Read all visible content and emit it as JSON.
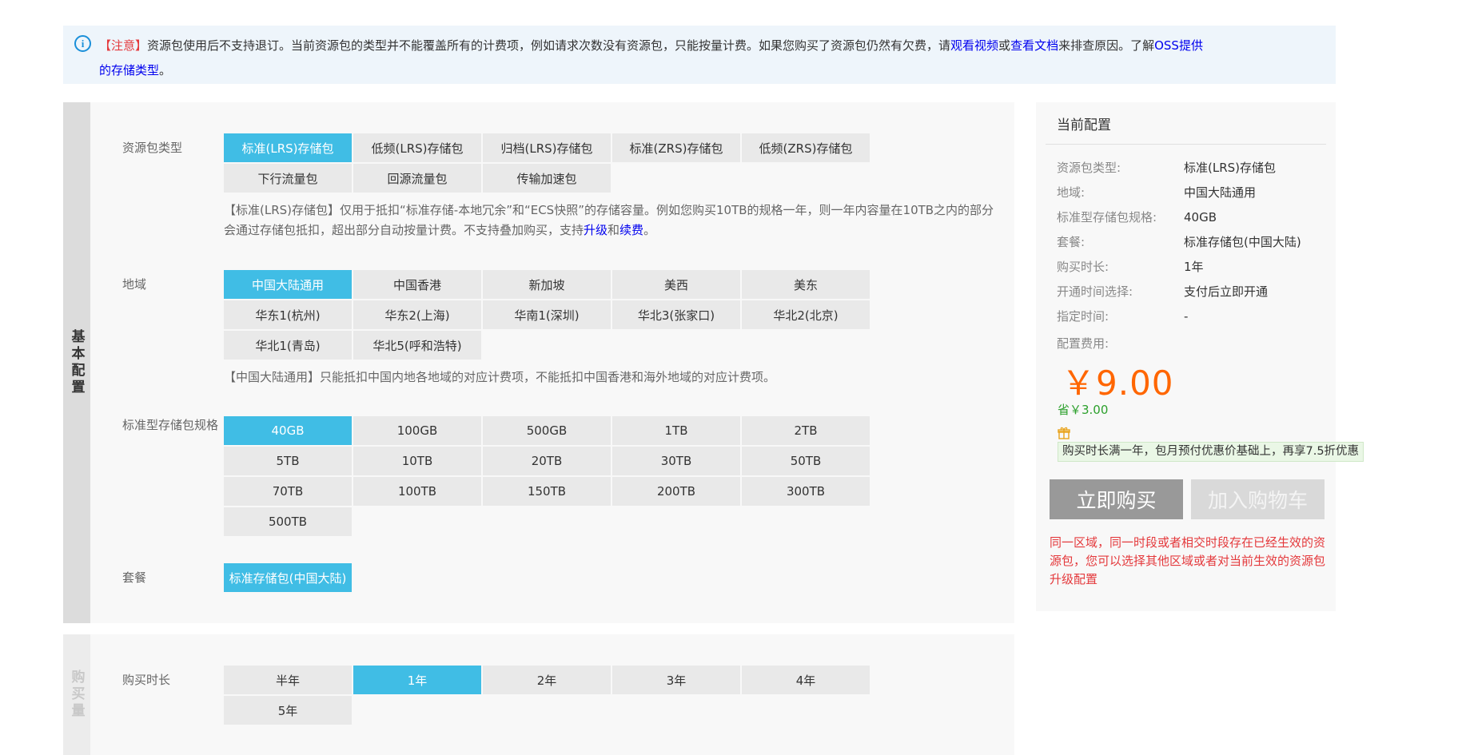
{
  "notice": {
    "icon": "info-icon",
    "tag": "【注意】",
    "text1": "资源包使用后不支持退订。当前资源包的类型并不能覆盖所有的计费项，例如请求次数没有资源包，只能按量计费。如果您购买了资源包仍然有欠费，请",
    "link_video": "观看视频",
    "text_or": "或",
    "link_doc": "查看文档",
    "text2": "来排查原因。了解",
    "link_oss": "OSS提供的存储类型",
    "text_end": "。"
  },
  "basic": {
    "side_label": "基本配置",
    "package_type": {
      "label": "资源包类型",
      "options": [
        "标准(LRS)存储包",
        "低频(LRS)存储包",
        "归档(LRS)存储包",
        "标准(ZRS)存储包",
        "低频(ZRS)存储包",
        "下行流量包",
        "回源流量包",
        "传输加速包"
      ],
      "selected": "标准(LRS)存储包",
      "desc1": "【标准(LRS)存储包】仅用于抵扣“标准存储-本地冗余”和“ECS快照”的存储容量。例如您购买10TB的规格一年，则一年内容量在10TB之内的部分会通过存储包抵扣，超出部分自动按量计费。不支持叠加购买，支持",
      "link_upgrade": "升级",
      "desc_and": "和",
      "link_renew": "续费",
      "desc_end": "。"
    },
    "region": {
      "label": "地域",
      "options": [
        "中国大陆通用",
        "中国香港",
        "新加坡",
        "美西",
        "美东",
        "华东1(杭州)",
        "华东2(上海)",
        "华南1(深圳)",
        "华北3(张家口)",
        "华北2(北京)",
        "华北1(青岛)",
        "华北5(呼和浩特)"
      ],
      "selected": "中国大陆通用",
      "desc": "【中国大陆通用】只能抵扣中国内地各地域的对应计费项，不能抵扣中国香港和海外地域的对应计费项。"
    },
    "spec": {
      "label": "标准型存储包规格",
      "options": [
        "40GB",
        "100GB",
        "500GB",
        "1TB",
        "2TB",
        "5TB",
        "10TB",
        "20TB",
        "30TB",
        "50TB",
        "70TB",
        "100TB",
        "150TB",
        "200TB",
        "300TB",
        "500TB"
      ],
      "selected": "40GB"
    },
    "plan": {
      "label": "套餐",
      "options": [
        "标准存储包(中国大陆)"
      ],
      "selected": "标准存储包(中国大陆)"
    }
  },
  "purchase": {
    "side_label": "购买量",
    "duration": {
      "label": "购买时长",
      "options": [
        "半年",
        "1年",
        "2年",
        "3年",
        "4年",
        "5年"
      ],
      "selected": "1年"
    }
  },
  "summary": {
    "title": "当前配置",
    "rows": [
      {
        "key": "资源包类型:",
        "value": "标准(LRS)存储包"
      },
      {
        "key": "地域:",
        "value": "中国大陆通用"
      },
      {
        "key": "标准型存储包规格:",
        "value": "40GB"
      },
      {
        "key": "套餐:",
        "value": "标准存储包(中国大陆)"
      },
      {
        "key": "购买时长:",
        "value": "1年"
      },
      {
        "key": "开通时间选择:",
        "value": "支付后立即开通"
      },
      {
        "key": "指定时间:",
        "value": "-"
      }
    ],
    "fee_label": "配置费用:",
    "price": "￥9.00",
    "saving": "省￥3.00",
    "promo_icon": "gift-icon",
    "promo": "购买时长满一年，包月预付优惠价基础上，再享7.5折优惠",
    "buy_button": "立即购买",
    "cart_button": "加入购物车",
    "warning": "同一区域，同一时段或者相交时段存在已经生效的资源包，您可以选择其他区域或者对当前生效的资源包升级配置"
  },
  "colors": {
    "selected": "#40bde5",
    "price": "#ff6600",
    "saving": "#2ca02c",
    "warning": "#e4393c",
    "link": "#0000ee"
  }
}
